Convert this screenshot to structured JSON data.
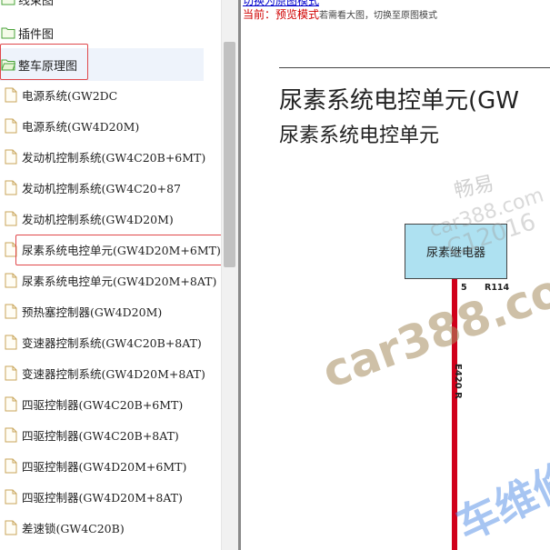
{
  "tree": {
    "items": [
      {
        "type": "folder",
        "label": "线束图"
      },
      {
        "type": "folder",
        "label": "插件图"
      },
      {
        "type": "folder",
        "label": "整车原理图",
        "open": true,
        "selected": true,
        "highlighted": true
      },
      {
        "type": "doc",
        "label": "电源系统(GW2DC"
      },
      {
        "type": "doc",
        "label": "电源系统(GW4D20M)"
      },
      {
        "type": "doc",
        "label": "发动机控制系统(GW4C20B+6MT)"
      },
      {
        "type": "doc",
        "label": "发动机控制系统(GW4C20+87"
      },
      {
        "type": "doc",
        "label": "发动机控制系统(GW4D20M)"
      },
      {
        "type": "doc",
        "label": "尿素系统电控单元(GW4D20M+6MT)",
        "highlighted": true
      },
      {
        "type": "doc",
        "label": "尿素系统电控单元(GW4D20M+8AT)"
      },
      {
        "type": "doc",
        "label": "预热塞控制器(GW4D20M)"
      },
      {
        "type": "doc",
        "label": "变速器控制系统(GW4C20B+8AT)"
      },
      {
        "type": "doc",
        "label": "变速器控制系统(GW4D20M+8AT)"
      },
      {
        "type": "doc",
        "label": "四驱控制器(GW4C20B+6MT)"
      },
      {
        "type": "doc",
        "label": "四驱控制器(GW4C20B+8AT)"
      },
      {
        "type": "doc",
        "label": "四驱控制器(GW4D20M+6MT)"
      },
      {
        "type": "doc",
        "label": "四驱控制器(GW4D20M+8AT)"
      },
      {
        "type": "doc",
        "label": "差速锁(GW4C20B)"
      }
    ]
  },
  "content": {
    "top_link": "切换为原图模式",
    "mode_prefix": "当前：",
    "mode_value": "预览模式",
    "mode_hint": "若需看大图，切换至原图模式",
    "diagram": {
      "title": "尿素系统电控单元(GW",
      "subtitle": "尿素系统电控单元",
      "relay_label": "尿素继电器",
      "pin_label": "5",
      "connector_label": "R114",
      "wire_label": "E420 R"
    },
    "watermarks": [
      "畅易",
      "car388.com",
      "C12016",
      "car388.com",
      "车维修"
    ]
  },
  "colors": {
    "highlight": "#e0484b",
    "wire": "#d0001b",
    "relay_fill": "#aee1f1",
    "mode_red": "#d00000",
    "link_blue": "#0000cc"
  }
}
